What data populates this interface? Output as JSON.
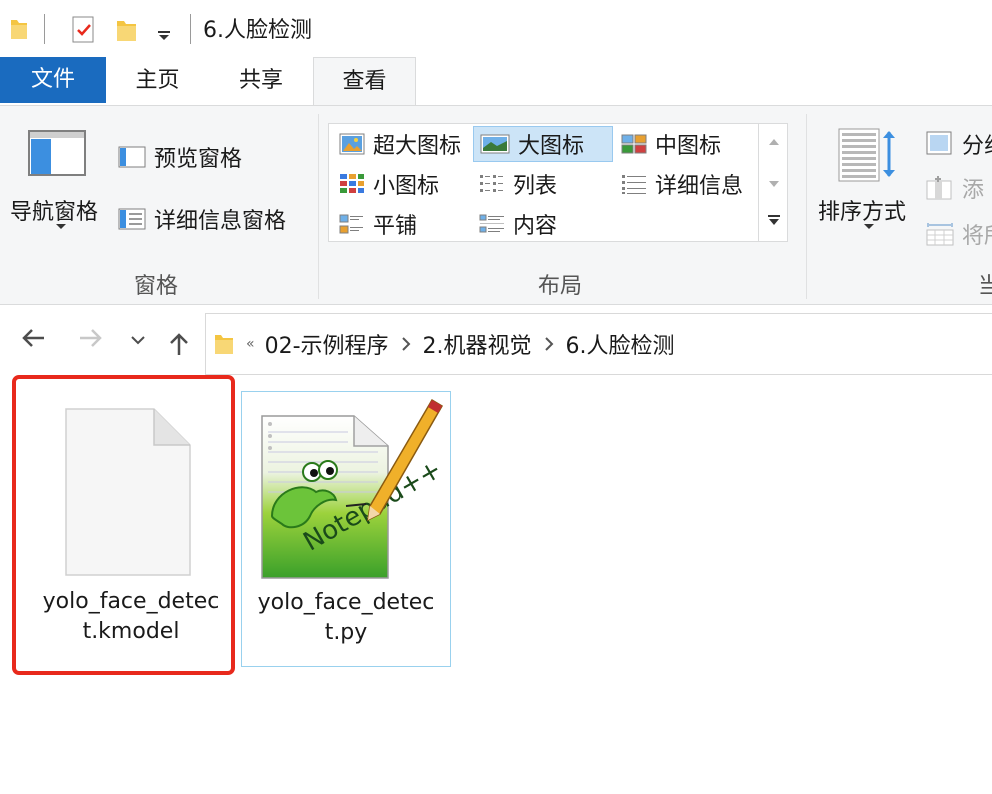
{
  "window": {
    "title": "6.人脸检测",
    "quick_access": [
      "folder-icon",
      "properties-icon",
      "new-folder-icon",
      "customize-dropdown-icon"
    ]
  },
  "ribbon_tabs": [
    {
      "label": "文件",
      "active": false,
      "style": "file"
    },
    {
      "label": "主页",
      "active": false
    },
    {
      "label": "共享",
      "active": false
    },
    {
      "label": "查看",
      "active": true
    }
  ],
  "ribbon": {
    "panes_group": {
      "label": "窗格",
      "navigation_pane": "导航窗格",
      "preview_pane": "预览窗格",
      "details_pane": "详细信息窗格"
    },
    "layout_group": {
      "label": "布局",
      "options": [
        {
          "label": "超大图标",
          "icon": "extra-large-icons-icon",
          "selected": false
        },
        {
          "label": "大图标",
          "icon": "large-icons-icon",
          "selected": true
        },
        {
          "label": "中图标",
          "icon": "medium-icons-icon",
          "selected": false
        },
        {
          "label": "小图标",
          "icon": "small-icons-icon",
          "selected": false
        },
        {
          "label": "列表",
          "icon": "list-icon",
          "selected": false
        },
        {
          "label": "详细信息",
          "icon": "details-icon",
          "selected": false
        },
        {
          "label": "平铺",
          "icon": "tiles-icon",
          "selected": false
        },
        {
          "label": "内容",
          "icon": "content-icon",
          "selected": false
        }
      ]
    },
    "current_view_group": {
      "sort_by": "排序方式",
      "group_by_partial": "分组",
      "add_columns_partial": "添",
      "size_columns_partial": "将所",
      "label_partial": "当"
    }
  },
  "navigation": {
    "back": "back-arrow-icon",
    "forward": "forward-arrow-icon",
    "recent": "recent-locations-chevron-icon",
    "up": "up-arrow-icon",
    "overflow": "«",
    "breadcrumbs": [
      "02-示例程序",
      "2.机器视觉",
      "6.人脸检测"
    ]
  },
  "files": [
    {
      "name_line1": "yolo_face_detec",
      "name_line2": "t.kmodel",
      "icon": "blank-file-icon",
      "highlighted": true
    },
    {
      "name_line1": "yolo_face_detec",
      "name_line2": "t.py",
      "icon": "notepad-plus-plus-icon",
      "highlighted": false
    }
  ],
  "colors": {
    "file_tab": "#1a6bbf",
    "selection": "#cce4f7",
    "highlight_box": "#e8291c"
  }
}
